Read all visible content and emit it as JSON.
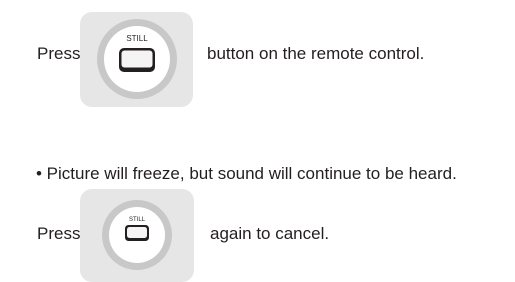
{
  "step1": {
    "prefix": "Press",
    "button_label": "STILL",
    "suffix": "button on the remote control."
  },
  "note": "• Picture will freeze, but sound will continue to be heard.",
  "step2": {
    "prefix": "Press",
    "button_label": "STILL",
    "suffix": "again to cancel."
  },
  "colors": {
    "text": "#231f20",
    "tile_background": "#e6e6e6",
    "ring": "#c8c8c8",
    "button_face": "#f4f4f4",
    "button_outline": "#231f20"
  }
}
